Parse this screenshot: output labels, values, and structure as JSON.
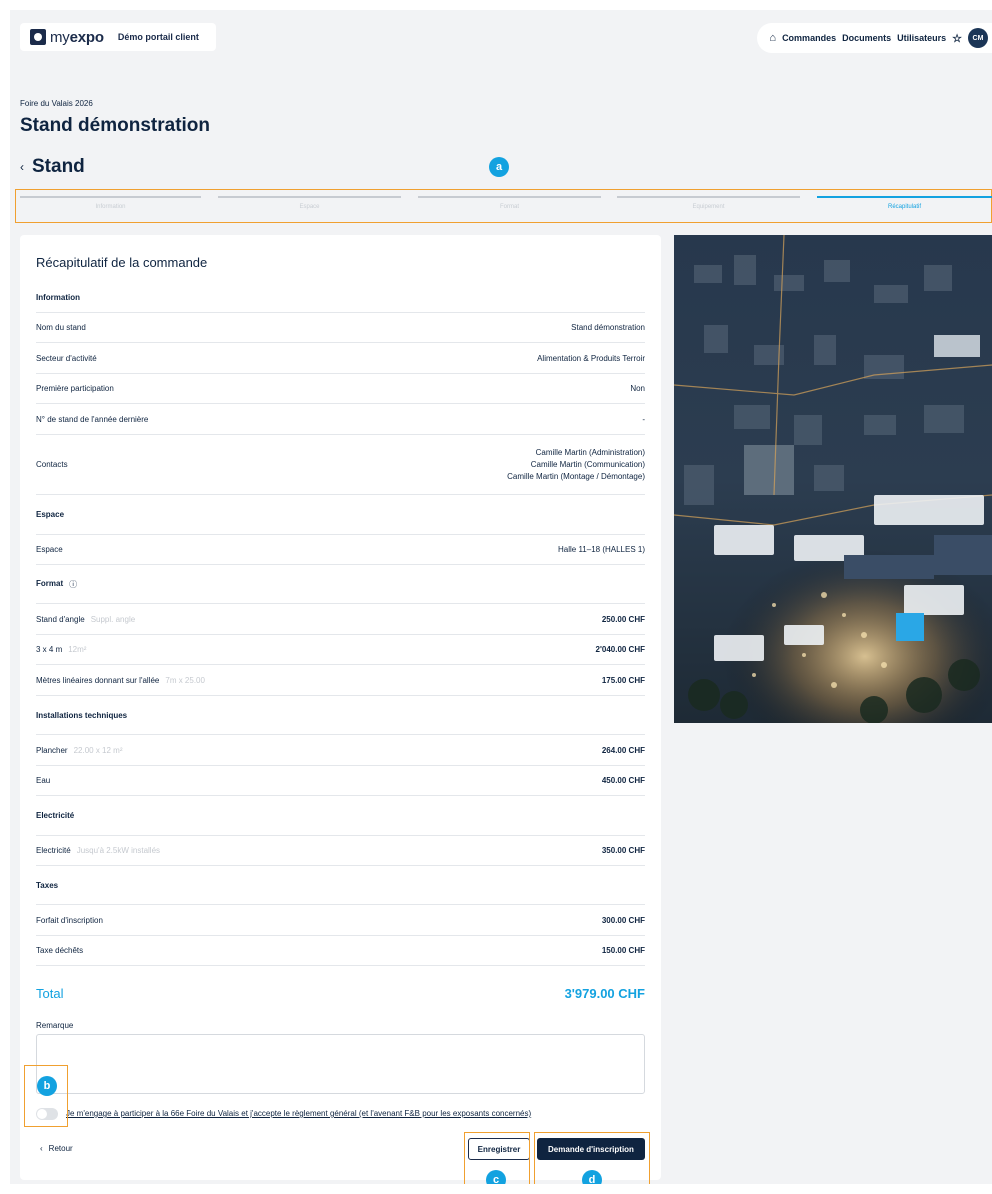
{
  "header": {
    "logo_text_light": "my",
    "logo_text_bold": "expo",
    "portal_name": "Démo portail client",
    "nav": [
      "Commandes",
      "Documents",
      "Utilisateurs"
    ],
    "avatar_initials": "CM"
  },
  "fair_name": "Foire du Valais 2026",
  "page_title": "Stand démonstration",
  "section_title": "Stand",
  "stepper": {
    "steps": [
      "Information",
      "Espace",
      "Format",
      "Equipement",
      "Récapitulatif"
    ],
    "active_index": 4
  },
  "annotations": [
    "a",
    "b",
    "c",
    "d"
  ],
  "summary": {
    "title": "Récapitulatif de la commande",
    "information": {
      "heading": "Information",
      "rows": [
        {
          "label": "Nom du stand",
          "value": "Stand démonstration"
        },
        {
          "label": "Secteur d'activité",
          "value": "Alimentation & Produits Terroir"
        },
        {
          "label": "Première participation",
          "value": "Non"
        },
        {
          "label": "N° de stand de l'année dernière",
          "value": "-"
        }
      ],
      "contacts_label": "Contacts",
      "contacts": [
        "Camille Martin (Administration)",
        "Camille Martin (Communication)",
        "Camille Martin (Montage / Démontage)"
      ]
    },
    "espace": {
      "heading": "Espace",
      "label": "Espace",
      "value": "Halle 11–18 (HALLES 1)"
    },
    "format": {
      "heading": "Format",
      "rows": [
        {
          "label": "Stand d'angle",
          "note": "Suppl. angle",
          "value": "250.00 CHF"
        },
        {
          "label": "3 x 4 m",
          "note": "12m²",
          "value": "2'040.00 CHF"
        },
        {
          "label": "Mètres linéaires donnant sur l'allée",
          "note": "7m x 25.00",
          "value": "175.00 CHF"
        }
      ]
    },
    "installations": {
      "heading": "Installations techniques",
      "rows": [
        {
          "label": "Plancher",
          "note": "22.00 x 12 m²",
          "value": "264.00 CHF"
        },
        {
          "label": "Eau",
          "note": "",
          "value": "450.00 CHF"
        }
      ]
    },
    "electricite": {
      "heading": "Electricité",
      "label": "Electricité",
      "note": "Jusqu'à 2.5kW installés",
      "value": "350.00 CHF"
    },
    "taxes": {
      "heading": "Taxes",
      "rows": [
        {
          "label": "Forfait d'inscription",
          "value": "300.00 CHF"
        },
        {
          "label": "Taxe déchêts",
          "value": "150.00 CHF"
        }
      ]
    },
    "total_label": "Total",
    "total_value": "3'979.00 CHF"
  },
  "form": {
    "remark_label": "Remarque",
    "remark_value": "",
    "consent_checked": false,
    "consent_text": "Je m'engage à participer à la 66e Foire du Valais et j'accepte le règlement général (et l'avenant F&B pour les exposants concernés)"
  },
  "actions": {
    "back": "Retour",
    "save": "Enregistrer",
    "submit": "Demande d'inscription"
  },
  "colors": {
    "accent": "#13a2e0",
    "navy": "#0f2440",
    "annotation": "#f0a030"
  }
}
